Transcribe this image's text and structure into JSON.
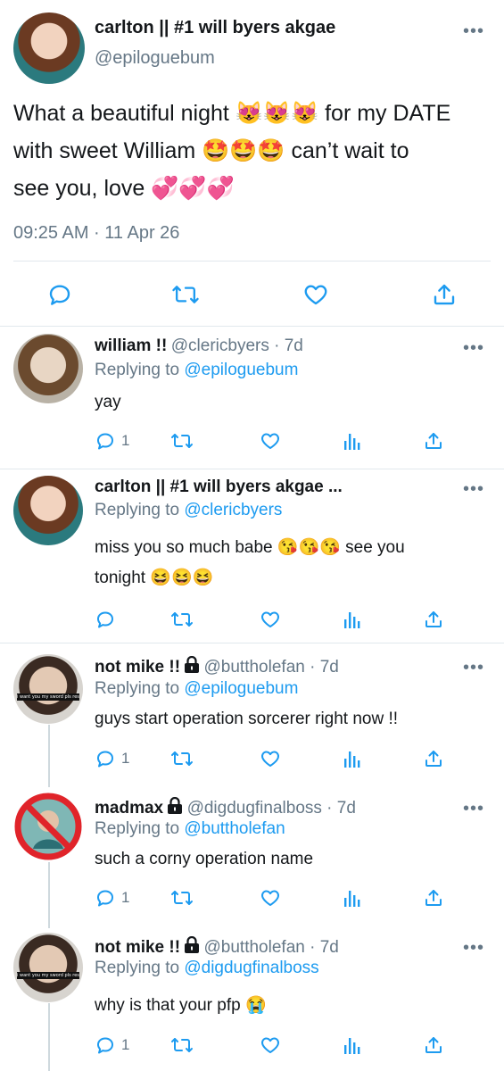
{
  "main_tweet": {
    "name": "carlton || #1 will byers akgae",
    "handle": "@epiloguebum",
    "line1": "What a beautiful night 😻😻😻 for my DATE",
    "line2": "with sweet William 🤩🤩🤩 can’t wait to",
    "line3": "see you, love 💞💞💞",
    "timestamp": "09:25 AM · 11 Apr 26"
  },
  "replies": [
    {
      "name": "william !!",
      "handle": "@clericbyers · 7d",
      "replying_prefix": "Replying to ",
      "replying_to": "@epiloguebum",
      "text": "yay",
      "reply_count": "1"
    },
    {
      "name": "carlton || #1 will byers akgae ...",
      "replying_prefix": "Replying to ",
      "replying_to": "@clericbyers",
      "text_line1": "miss you so much babe 😘😘😘 see you",
      "text_line2": "tonight 😆😆😆"
    },
    {
      "name": "not mike !!",
      "handle": "@buttholefan · 7d",
      "replying_prefix": "Replying to ",
      "replying_to": "@epiloguebum",
      "text": "guys start operation sorcerer right now !!",
      "reply_count": "1",
      "avatar_caption": "i want you my sword pls respond"
    },
    {
      "name": "madmax",
      "handle": "@digdugfinalboss · 7d",
      "replying_prefix": "Replying to ",
      "replying_to": "@buttholefan",
      "text": "such a corny operation name",
      "reply_count": "1"
    },
    {
      "name": "not mike !!",
      "handle": "@buttholefan · 7d",
      "replying_prefix": "Replying to ",
      "replying_to": "@digdugfinalboss",
      "text": "why is that your pfp 😭",
      "reply_count": "1",
      "avatar_caption": "i want you my sword pls respond"
    }
  ],
  "icons": {
    "more": "more-horizontal-icon",
    "reply": "reply-icon",
    "retweet": "retweet-icon",
    "like": "heart-icon",
    "share": "share-icon",
    "analytics": "analytics-icon",
    "lock": "lock-icon"
  },
  "colors": {
    "link": "#1d9bf0",
    "muted": "#657786",
    "text": "#14171a",
    "divider": "#e1e8ed"
  }
}
